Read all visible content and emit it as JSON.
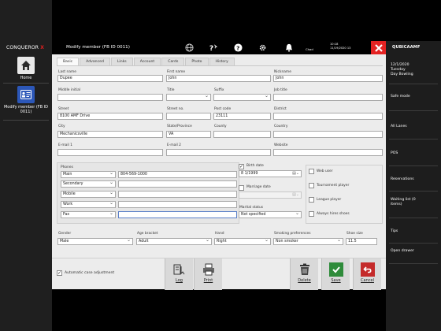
{
  "brand": {
    "name": "CONQUEROR",
    "mark": "X"
  },
  "left_nav": [
    {
      "label": "Home"
    },
    {
      "label": "Modify member (FB ID 0011)"
    }
  ],
  "topbar": {
    "title": "Modify member (FB ID 0011)",
    "user": "Chad",
    "time": "10:18",
    "date": "11/19/2020 13"
  },
  "right_panel": {
    "logo": "QUBICAAMF",
    "date": "12/1/2020",
    "day": "Tuesday",
    "mode_name": "Day Bowling",
    "items": [
      {
        "label": "Safe mode"
      },
      {
        "label": "All Lanes"
      },
      {
        "label": "POS"
      },
      {
        "label": "Reservations"
      },
      {
        "label": "Waiting list (0 items)"
      },
      {
        "label": "Tips"
      },
      {
        "label": "Open drawer"
      }
    ]
  },
  "tabs": [
    "Basic",
    "Advanced",
    "Links",
    "Account",
    "Cards",
    "Photo",
    "History"
  ],
  "form": {
    "last_name": {
      "label": "Last name",
      "value": "Dupee"
    },
    "first_name": {
      "label": "First name",
      "value": "John"
    },
    "nickname": {
      "label": "Nickname",
      "value": "John"
    },
    "middle_initial": {
      "label": "Middle initial",
      "value": ""
    },
    "title": {
      "label": "Title",
      "value": ""
    },
    "suffix": {
      "label": "Suffix",
      "value": ""
    },
    "job_title": {
      "label": "Job title",
      "value": ""
    },
    "street": {
      "label": "Street",
      "value": "8100 AMF Drive"
    },
    "street_no": {
      "label": "Street no.",
      "value": ""
    },
    "post_code": {
      "label": "Post code",
      "value": "23111"
    },
    "district": {
      "label": "District",
      "value": ""
    },
    "city": {
      "label": "City",
      "value": "Mechanicsville"
    },
    "state": {
      "label": "State/Province",
      "value": "VA"
    },
    "county": {
      "label": "County",
      "value": ""
    },
    "country": {
      "label": "Country",
      "value": ""
    },
    "email1": {
      "label": "E-mail 1",
      "value": ""
    },
    "email2": {
      "label": "E-mail 2",
      "value": ""
    },
    "website": {
      "label": "Website",
      "value": ""
    },
    "phones_label": "Phones",
    "phones": [
      {
        "type": "Main",
        "value": "804-569-1000"
      },
      {
        "type": "Secondary",
        "value": ""
      },
      {
        "type": "Mobile",
        "value": ""
      },
      {
        "type": "Work",
        "value": ""
      },
      {
        "type": "Fax",
        "value": ""
      }
    ],
    "birth_date": {
      "label": "Birth date",
      "value": "8 1/1999",
      "checked": true
    },
    "marriage_date": {
      "label": "Marriage date",
      "value": "",
      "checked": false
    },
    "marital_status": {
      "label": "Marital status",
      "value": "Not specified"
    },
    "options": [
      {
        "label": "Web user",
        "checked": false
      },
      {
        "label": "Tournament player",
        "checked": false
      },
      {
        "label": "League player",
        "checked": false
      },
      {
        "label": "Always hires shoes",
        "checked": false
      }
    ],
    "gender": {
      "label": "Gender",
      "value": "Male"
    },
    "age_bracket": {
      "label": "Age bracket",
      "value": "Adult"
    },
    "hand": {
      "label": "Hand",
      "value": "Right"
    },
    "smoking": {
      "label": "Smoking preferences",
      "value": "Non smoker"
    },
    "shoe_size": {
      "label": "Shoe size",
      "value": "11.5"
    }
  },
  "bottom": {
    "auto_case": "Automatic case adjustment",
    "log": "Log",
    "print": "Print",
    "delete": "Delete",
    "save": "Save",
    "cancel": "Cancel"
  },
  "colors": {
    "accent_red": "#e42222",
    "accent_green": "#2e8b3a",
    "accent_blue": "#2c57b8"
  }
}
